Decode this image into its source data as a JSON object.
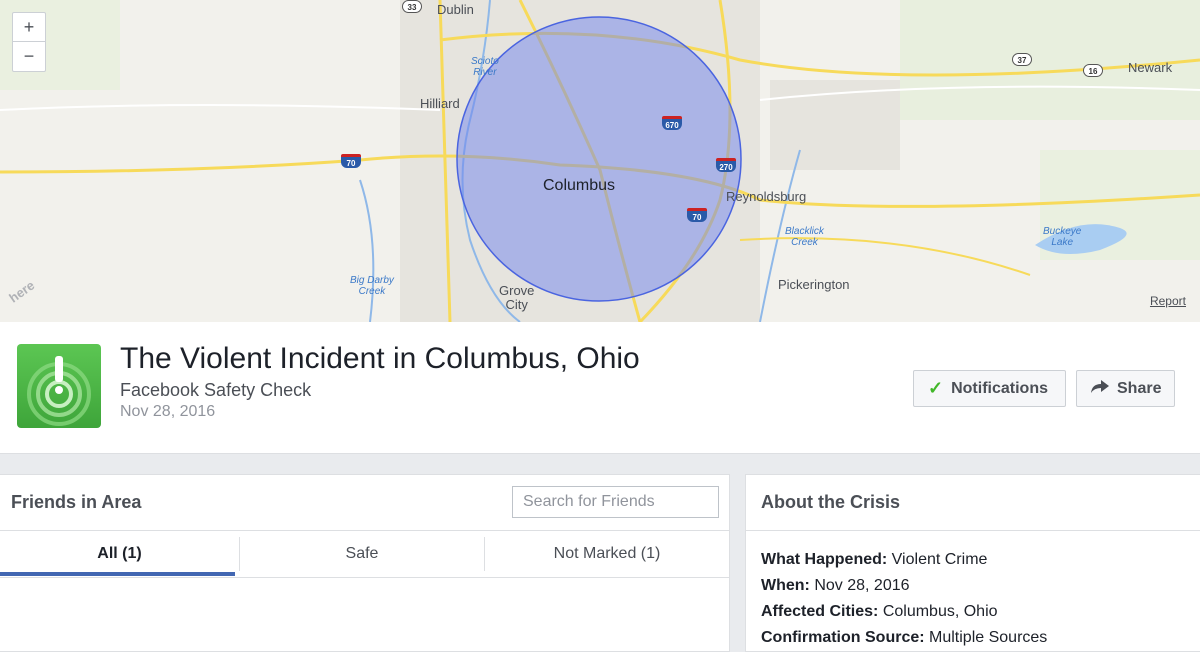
{
  "map": {
    "labels": {
      "dublin": "Dublin",
      "hilliard": "Hilliard",
      "columbus": "Columbus",
      "reynoldsburg": "Reynoldsburg",
      "pickerington": "Pickerington",
      "grove_city": "Grove\nCity",
      "newark": "Newark",
      "scioto_river": "Scioto\nRiver",
      "big_darby_creek": "Big Darby\nCreek",
      "blacklick_creek": "Blacklick\nCreek",
      "buckeye_lake": "Buckeye\nLake"
    },
    "shields": {
      "us33": "33",
      "i670": "670",
      "i270": "270",
      "i70_west": "70",
      "i70_east": "70",
      "us37": "37",
      "us16": "16"
    },
    "zoom_in": "+",
    "zoom_out": "−",
    "provider": "here",
    "report_link": "Report",
    "circle_color": "#5b74e8"
  },
  "event": {
    "title": "The Violent Incident in Columbus, Ohio",
    "subtitle": "Facebook Safety Check",
    "date": "Nov 28, 2016",
    "notifications_label": "Notifications",
    "share_label": "Share"
  },
  "friends": {
    "title": "Friends in Area",
    "search_placeholder": "Search for Friends",
    "tabs": [
      {
        "label": "All (1)",
        "active": true
      },
      {
        "label": "Safe",
        "active": false
      },
      {
        "label": "Not Marked (1)",
        "active": false
      }
    ]
  },
  "about": {
    "title": "About the Crisis",
    "items": [
      {
        "key": "What Happened:",
        "value": "Violent Crime"
      },
      {
        "key": "When:",
        "value": "Nov 28, 2016"
      },
      {
        "key": "Affected Cities:",
        "value": "Columbus, Ohio"
      },
      {
        "key": "Confirmation Source:",
        "value": "Multiple Sources"
      }
    ]
  },
  "colors": {
    "accent": "#4267b2",
    "safety_green": "#42b72a"
  }
}
